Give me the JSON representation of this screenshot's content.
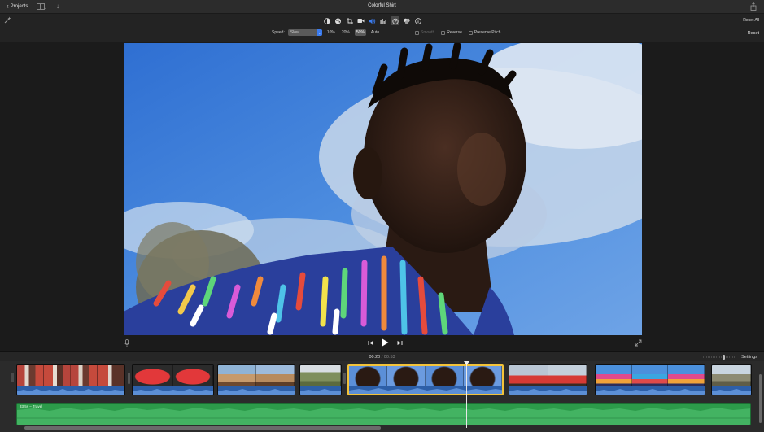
{
  "titlebar": {
    "back_label": "Projects",
    "title": "Colorful Shirt"
  },
  "toolbar": {
    "reset_all_label": "Reset All",
    "reset_label": "Reset",
    "speed_label": "Speed:",
    "speed_value": "Slow",
    "speed_options": [
      "10%",
      "20%",
      "50%",
      "Auto"
    ],
    "speed_selected": "50%",
    "smooth_label": "Smooth",
    "reverse_label": "Reverse",
    "preserve_pitch_label": "Preserve Pitch",
    "icons": [
      "color-balance-icon",
      "color-correction-icon",
      "crop-icon",
      "stabilization-icon",
      "volume-icon",
      "equalizer-icon",
      "speed-icon",
      "noise-reduction-icon",
      "clip-info-icon"
    ],
    "active_icon": "speed-icon"
  },
  "viewer": {
    "icons": [
      "microphone-icon",
      "skip-back-icon",
      "play-icon",
      "skip-forward-icon",
      "fullscreen-icon"
    ]
  },
  "timeline": {
    "current_time": "00:20",
    "separator": "/",
    "total_time": "00:53",
    "settings_label": "Settings",
    "music_label": "33.5s – Travel",
    "colors": {
      "video_clip": "#2d5fa8",
      "audio_track": "#2c9b4a",
      "selection": "#f3c33a",
      "toolbar_accent": "#3b7cf0"
    }
  }
}
